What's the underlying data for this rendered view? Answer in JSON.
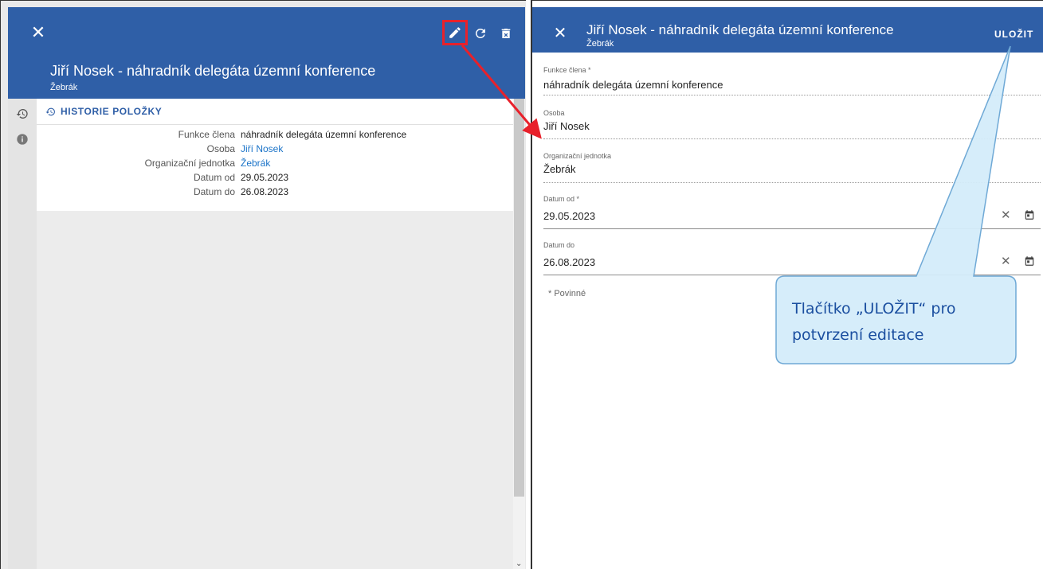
{
  "left": {
    "title": "Jiří Nosek - náhradník delegáta územní konference",
    "subtitle": "Žebrák",
    "close_icon": "close-icon",
    "toolbar_icons": [
      "edit-icon",
      "refresh-icon",
      "delete-icon"
    ],
    "history_heading": "HISTORIE POLOŽKY",
    "rows": [
      {
        "label": "Funkce člena",
        "value": "náhradník delegáta územní konference"
      },
      {
        "label": "Osoba",
        "value": "Jiří Nosek"
      },
      {
        "label": "Organizační jednotka",
        "value": "Žebrák"
      },
      {
        "label": "Datum od",
        "value": "29.05.2023"
      },
      {
        "label": "Datum do",
        "value": "26.08.2023"
      }
    ]
  },
  "right": {
    "title": "Jiří Nosek - náhradník delegáta územní konference",
    "subtitle": "Žebrák",
    "save_label": "ULOŽIT",
    "fields": {
      "funkce": {
        "label": "Funkce člena *",
        "value": "náhradník delegáta územní konference"
      },
      "osoba": {
        "label": "Osoba",
        "value": "Jiří Nosek"
      },
      "org": {
        "label": "Organizační jednotka",
        "value": "Žebrák"
      },
      "datum_od": {
        "label": "Datum od *",
        "value": "29.05.2023"
      },
      "datum_do": {
        "label": "Datum do",
        "value": "26.08.2023"
      }
    },
    "required_note": "* Povinné"
  },
  "annotation": {
    "callout_line1": "Tlačítko „ULOŽIT“ pro",
    "callout_line2": "potvrzení editace",
    "arrow_color": "#e8212b",
    "callout_fill": "#d4ecfa",
    "callout_stroke": "#6fa9d6"
  },
  "colors": {
    "header_blue": "#2f5fa7",
    "link_blue": "#1a73c8"
  }
}
